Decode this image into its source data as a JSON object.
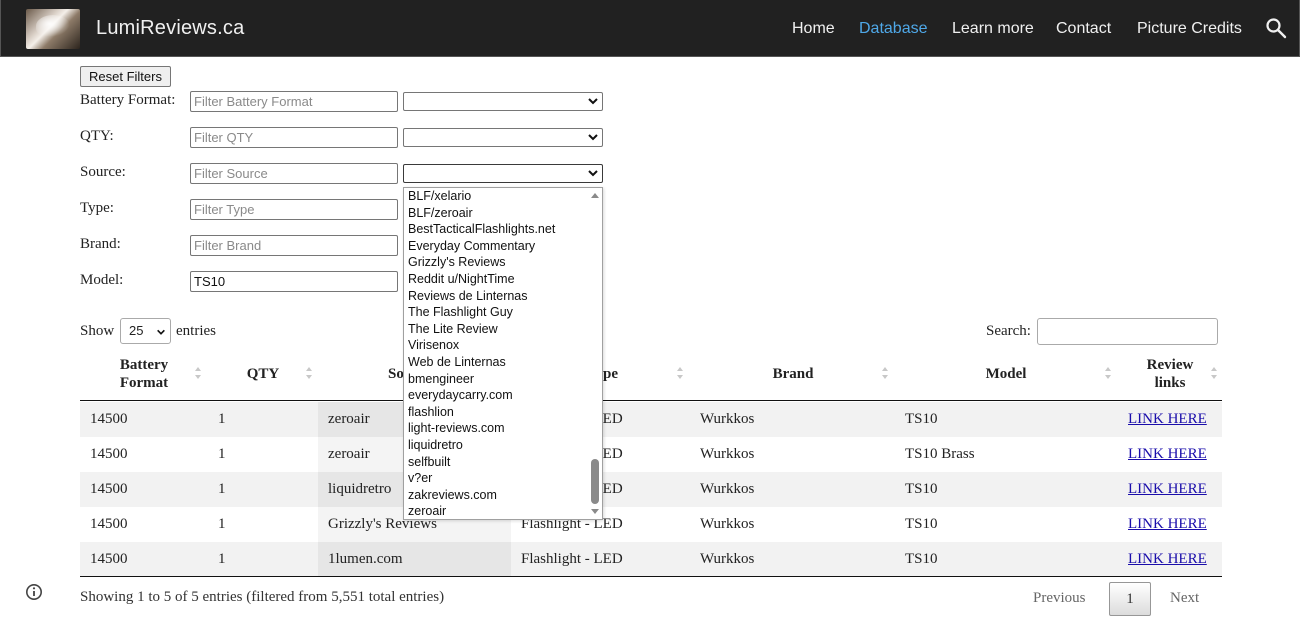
{
  "header": {
    "site_title": "LumiReviews.ca",
    "nav": [
      {
        "label": "Home",
        "active": false
      },
      {
        "label": "Database",
        "active": true
      },
      {
        "label": "Learn more",
        "active": false
      },
      {
        "label": "Contact",
        "active": false
      },
      {
        "label": "Picture Credits",
        "active": false
      }
    ],
    "search_icon": "search-icon",
    "active_color": "#4fa8e8",
    "bar_color": "#212121"
  },
  "filters": {
    "reset_label": "Reset Filters",
    "rows": [
      {
        "label": "Battery Format:",
        "placeholder": "Filter Battery Format",
        "value": ""
      },
      {
        "label": "QTY:",
        "placeholder": "Filter QTY",
        "value": ""
      },
      {
        "label": "Source:",
        "placeholder": "Filter Source",
        "value": ""
      },
      {
        "label": "Type:",
        "placeholder": "Filter Type",
        "value": ""
      },
      {
        "label": "Brand:",
        "placeholder": "Filter Brand",
        "value": ""
      },
      {
        "label": "Model:",
        "placeholder": "Filter Model",
        "value": "TS10"
      }
    ],
    "source_dropdown_options": [
      "BLF/xelario",
      "BLF/zeroair",
      "BestTacticalFlashlights.net",
      "Everyday Commentary",
      "Grizzly's Reviews",
      "Reddit u/NightTime",
      "Reviews de Linternas",
      "The Flashlight Guy",
      "The Lite Review",
      "Virisenox",
      "Web de Linternas",
      "bmengineer",
      "everydaycarry.com",
      "flashlion",
      "light-reviews.com",
      "liquidretro",
      "selfbuilt",
      "v?er",
      "zakreviews.com",
      "zeroair"
    ]
  },
  "table_controls": {
    "show_label": "Show",
    "page_length": "25",
    "entries_label": "entries",
    "search_label": "Search:",
    "search_value": ""
  },
  "table": {
    "columns": [
      "Battery Format",
      "QTY",
      "Source",
      "Type",
      "Brand",
      "Model",
      "Review links"
    ],
    "visible_header_fragments": {
      "Source": "So",
      "Type": "pe"
    },
    "rows": [
      {
        "battery": "14500",
        "qty": "1",
        "source": "zeroair",
        "type": "Flashlight - LED",
        "brand": "Wurkkos",
        "model": "TS10",
        "link": "LINK HERE"
      },
      {
        "battery": "14500",
        "qty": "1",
        "source": "zeroair",
        "type": "Flashlight - LED",
        "brand": "Wurkkos",
        "model": "TS10 Brass",
        "link": "LINK HERE"
      },
      {
        "battery": "14500",
        "qty": "1",
        "source": "liquidretro",
        "type": "Flashlight - LED",
        "brand": "Wurkkos",
        "model": "TS10",
        "link": "LINK HERE"
      },
      {
        "battery": "14500",
        "qty": "1",
        "source": "Grizzly's Reviews",
        "type": "Flashlight - LED",
        "brand": "Wurkkos",
        "model": "TS10",
        "link": "LINK HERE"
      },
      {
        "battery": "14500",
        "qty": "1",
        "source": "1lumen.com",
        "type": "Flashlight - LED",
        "brand": "Wurkkos",
        "model": "TS10",
        "link": "LINK HERE"
      }
    ],
    "link_color": "#1a0dab"
  },
  "footer": {
    "info": "Showing 1 to 5 of 5 entries (filtered from 5,551 total entries)",
    "previous_label": "Previous",
    "current_page": "1",
    "next_label": "Next",
    "info_icon": "info-icon"
  }
}
